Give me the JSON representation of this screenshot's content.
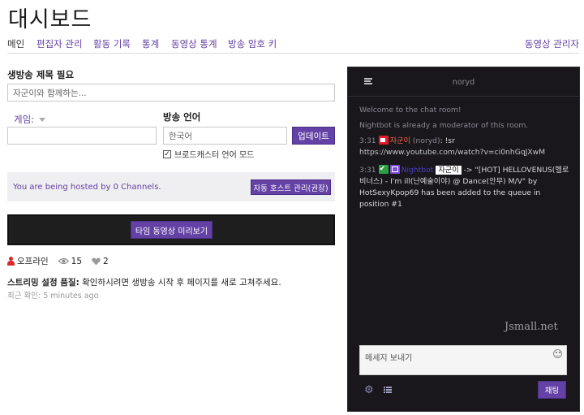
{
  "header": {
    "title": "대시보드"
  },
  "tabs": [
    {
      "label": "메인",
      "active": true
    },
    {
      "label": "편집자 관리"
    },
    {
      "label": "활동 기록"
    },
    {
      "label": "통계"
    },
    {
      "label": "동영상 통계"
    },
    {
      "label": "방송 암호 키"
    }
  ],
  "video_manager_link": "동영상 관리자",
  "form": {
    "title_label": "생방송 제목 필요",
    "title_value": "자군이와 함께하는...",
    "game_label": "게임:",
    "game_value": "",
    "language_label": "방송 언어",
    "language_value": "한국어",
    "update_button": "업데이트",
    "broadcaster_language_mode": "브로드캐스터 언어 모드",
    "broadcaster_language_checked": "✓"
  },
  "hosting": {
    "text": "You are being hosted by 0 Channels.",
    "auto_host_button": "자동 호스트 관리(권장)"
  },
  "preview": {
    "button": "타임 동영상 미리보기"
  },
  "stats": {
    "status": "오프라인",
    "viewers": "15",
    "hearts": "2"
  },
  "stream_quality": {
    "label": "스트리밍 설정 품질:",
    "text": " 확인하시려면 생방송 시작 후 페이지를 새로 고쳐주세요.",
    "last_checked": "최근 확인: 5 minutes ago"
  },
  "chat": {
    "channel": "noryd",
    "system_messages": [
      "Welcome to the chat room!",
      "Nightbot is already a moderator of this room."
    ],
    "messages": [
      {
        "time": "3:31",
        "user": "자군이",
        "tag": " (noryd)",
        "text": ": !sr ",
        "link": "https://www.youtube.com/watch?v=ci0nhGqJXwM"
      },
      {
        "time": "3:31",
        "user": "Nightbot",
        "mention": "자군이",
        "text": " -> \"[HOT] HELLOVENUS(헬로비너스) - I'm ill(난예술이야) @ Dance(안무) M/V\" by HotSexyKpop69 has been added to the queue in position #1"
      }
    ],
    "input_placeholder": "메세지 보내기",
    "send_button": "채팅",
    "watermark": "Jsmall.net"
  },
  "icons": {
    "status": "person-icon",
    "viewers": "eye-icon",
    "hearts": "heart-icon",
    "settings": "gear-icon",
    "list": "list-icon",
    "menu": "menu-icon",
    "emoji": "smile-icon"
  },
  "colors": {
    "accent": "#6441a4",
    "chat_bg": "#19171c",
    "offline": "#d92b2b"
  }
}
